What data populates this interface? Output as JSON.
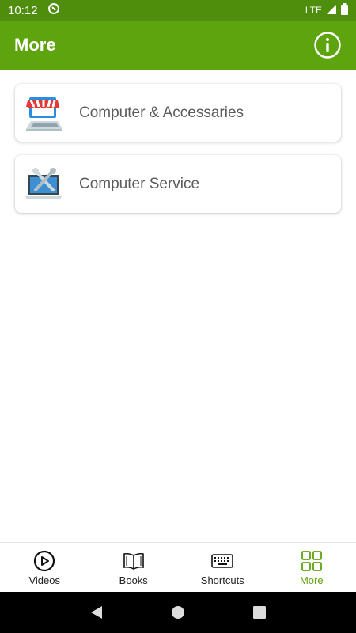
{
  "status_bar": {
    "time": "10:12",
    "network": "LTE"
  },
  "app_bar": {
    "title": "More"
  },
  "items": [
    {
      "label": "Computer & Accessaries",
      "icon": "laptop-shop-icon"
    },
    {
      "label": "Computer Service",
      "icon": "laptop-service-icon"
    }
  ],
  "bottom_nav": [
    {
      "label": "Videos",
      "icon": "play-circle-icon"
    },
    {
      "label": "Books",
      "icon": "book-icon"
    },
    {
      "label": "Shortcuts",
      "icon": "keyboard-icon"
    },
    {
      "label": "More",
      "icon": "grid-icon",
      "active": true
    }
  ],
  "colors": {
    "app_bar": "#5ea40e",
    "status_bar": "#4e8e0c",
    "active_nav": "#5ea40e"
  }
}
